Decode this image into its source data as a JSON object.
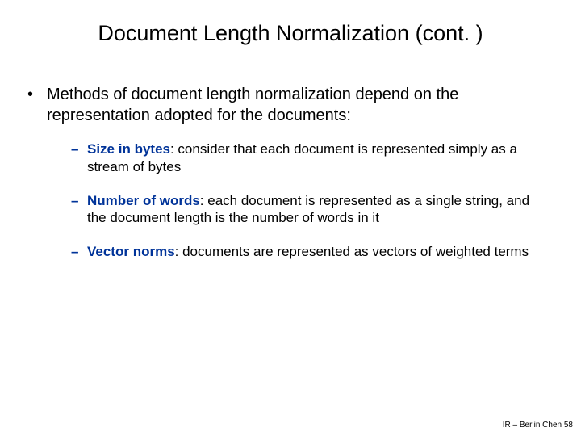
{
  "title": "Document Length Normalization (cont. )",
  "intro": "Methods of document length normalization depend on the representation adopted for the documents:",
  "methods": [
    {
      "lead": "Size in bytes",
      "rest": ": consider that each document is represented simply as a stream of bytes"
    },
    {
      "lead": "Number of words",
      "rest": ": each document is represented as a single string, and the document length is the number of words in it"
    },
    {
      "lead": "Vector norms",
      "rest": ": documents are represented as vectors of weighted terms"
    }
  ],
  "footer": "IR – Berlin Chen 58"
}
